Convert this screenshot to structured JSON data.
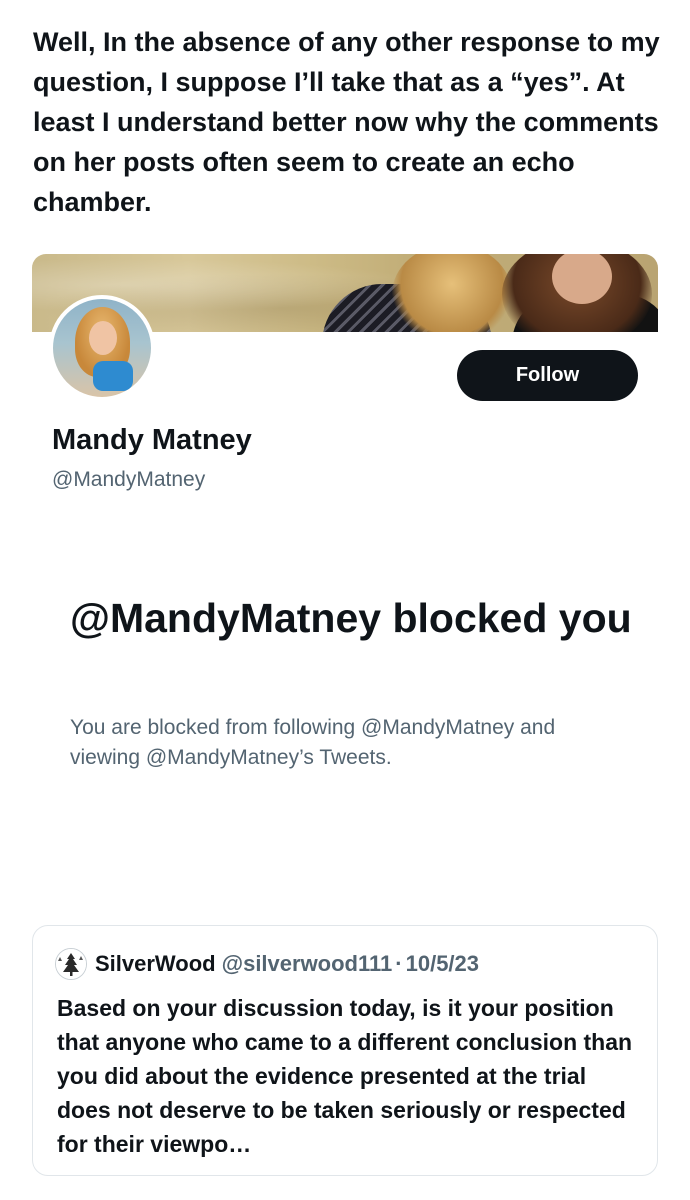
{
  "tweet": {
    "text": "Well, In the absence of any other response to my question, I suppose I’ll take that as a “yes”.  At least I understand better now why the comments on her posts often seem to create an echo chamber."
  },
  "profile": {
    "display_name": "Mandy Matney",
    "handle": "@MandyMatney",
    "follow_label": "Follow",
    "banner_icon": "banner-image",
    "avatar_icon": "profile-photo"
  },
  "blocked": {
    "title": "@MandyMatney blocked you",
    "description": "You are blocked from following @MandyMatney and viewing @MandyMatney’s Tweets."
  },
  "quote": {
    "author_name": "SilverWood",
    "author_handle": "@silverwood111",
    "separator": "·",
    "date": "10/5/23",
    "text": "Based on your discussion today, is it your position that anyone who came to a different conclusion than you did about the evidence presented at the trial does not deserve to be taken seriously or respected for their viewpo…",
    "avatar_icon": "tree-avatar-icon"
  },
  "colors": {
    "primary_text": "#0f1419",
    "secondary_text": "#536471",
    "button_bg": "#0f1419",
    "button_text": "#ffffff",
    "border": "#e1e6ea"
  }
}
